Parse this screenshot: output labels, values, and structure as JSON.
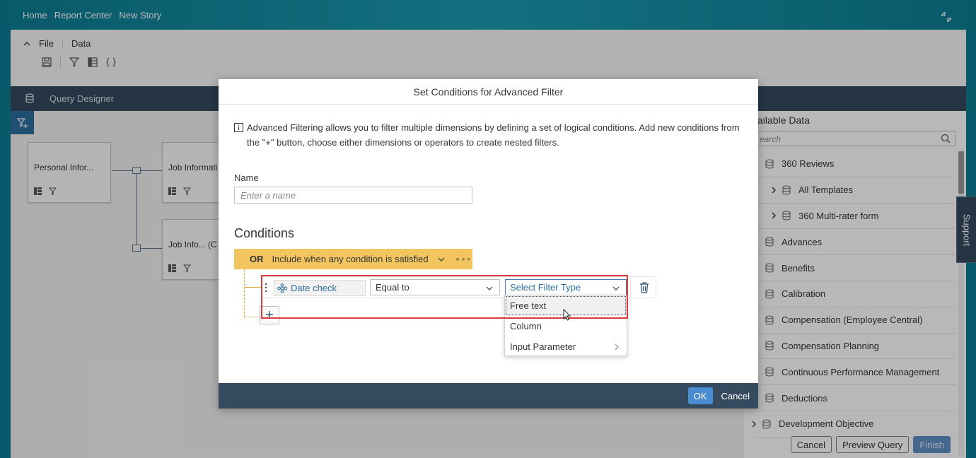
{
  "topbar": {
    "breadcrumbs": [
      "Home",
      "Report Center",
      "New Story"
    ]
  },
  "ribbon": {
    "tabs": [
      "File",
      "Data"
    ]
  },
  "query_designer": {
    "title": "Query Designer"
  },
  "canvas": {
    "nodes": [
      "Personal Infor...",
      "Job Informati",
      "Job Info... (C"
    ]
  },
  "side_panel": {
    "title": "ailable Data",
    "search_placeholder": "earch",
    "items": [
      {
        "label": "360 Reviews",
        "expandable": false
      },
      {
        "label": "All Templates",
        "expandable": true
      },
      {
        "label": "360 Multi-rater form",
        "expandable": true
      },
      {
        "label": "Advances",
        "expandable": false
      },
      {
        "label": "Benefits",
        "expandable": false
      },
      {
        "label": "Calibration",
        "expandable": false
      },
      {
        "label": "Compensation (Employee Central)",
        "expandable": false
      },
      {
        "label": "Compensation Planning",
        "expandable": false
      },
      {
        "label": "Continuous Performance Management",
        "expandable": false
      },
      {
        "label": "Deductions",
        "expandable": false
      },
      {
        "label": "Development Objective",
        "expandable": true
      }
    ]
  },
  "support": {
    "label": "Support"
  },
  "bottom_buttons": {
    "cancel": "Cancel",
    "preview": "Preview Query",
    "finish": "Finish"
  },
  "dialog": {
    "title": "Set Conditions for Advanced Filter",
    "info": "Advanced Filtering allows you to filter multiple dimensions by defining a set of logical conditions. Add new conditions from the \"+\" button, choose either dimensions or operators to create nested filters.",
    "name_label": "Name",
    "name_placeholder": "Enter a name",
    "conditions_title": "Conditions",
    "or_label": "OR",
    "or_description": "Include when any condition is satisfied",
    "condition": {
      "dimension": "Date check",
      "operator": "Equal to",
      "filter_type_placeholder": "Select Filter Type"
    },
    "add_label": "+",
    "dropdown_options": [
      "Free text",
      "Column",
      "Input Parameter"
    ],
    "ok": "OK",
    "cancel": "Cancel"
  },
  "colors": {
    "header_bg": "#354a5f",
    "or_bar": "#f3c55e",
    "accent": "#2f6e9f",
    "highlight": "#d93c3c"
  }
}
